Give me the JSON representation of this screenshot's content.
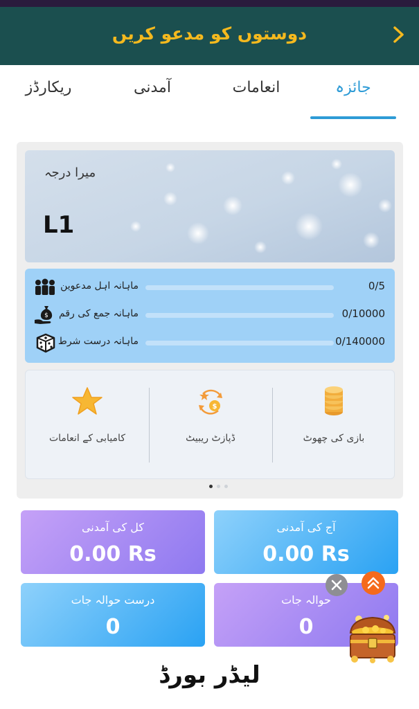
{
  "header": {
    "title": "دوستوں کو مدعو کریں"
  },
  "tabs": [
    {
      "label": "جائزہ",
      "active": true
    },
    {
      "label": "انعامات",
      "active": false
    },
    {
      "label": "آمدنی",
      "active": false
    },
    {
      "label": "ریکارڈز",
      "active": false
    }
  ],
  "level_card": {
    "label": "میرا درجہ",
    "level": "L1"
  },
  "progress": [
    {
      "label": "ماہانہ اہل مدعوین",
      "value": "0/5",
      "fraction": 0,
      "icon": "people-group-icon"
    },
    {
      "label": "ماہانہ جمع کی رقم",
      "value": "0/10000",
      "fraction": 0,
      "icon": "money-bag-hand-icon"
    },
    {
      "label": "ماہانہ درست شرط",
      "value": "0/140000",
      "fraction": 0,
      "icon": "dice-icon"
    }
  ],
  "features": [
    {
      "label": "کامیابی کے انعامات",
      "icon": "star-icon"
    },
    {
      "label": "ڈپازٹ ریبیٹ",
      "icon": "deposit-rebate-icon"
    },
    {
      "label": "بازی کی چھوٹ",
      "icon": "coin-stack-icon"
    }
  ],
  "stats": {
    "total_income": {
      "label": "کل کی آمدنی",
      "value": "0.00 Rs"
    },
    "today_income": {
      "label": "آج کی آمدنی",
      "value": "0.00 Rs"
    },
    "valid_referrals": {
      "label": "درست حوالہ جات",
      "value": "0"
    },
    "referrals": {
      "label": "حوالہ جات",
      "value": "0"
    }
  },
  "leaderboard": {
    "title": "لیڈر بورڈ"
  },
  "colors": {
    "header_bg": "#1b4f4f",
    "header_title": "#f5b91e",
    "accent": "#2e9bd6",
    "scroll_up": "#f56a1c"
  }
}
